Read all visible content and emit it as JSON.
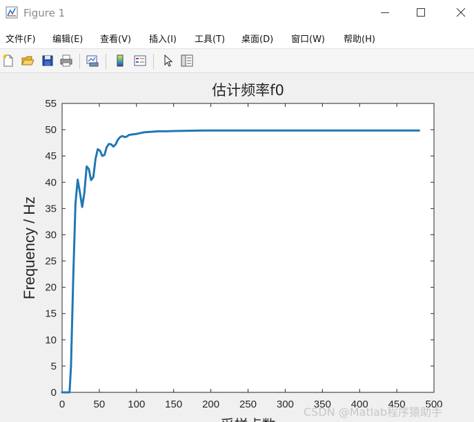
{
  "window": {
    "title": "Figure 1",
    "controls": [
      "minimize",
      "maximize",
      "close"
    ]
  },
  "menu": {
    "items": [
      "文件(F)",
      "编辑(E)",
      "查看(V)",
      "插入(I)",
      "工具(T)",
      "桌面(D)",
      "窗口(W)",
      "帮助(H)"
    ]
  },
  "toolbar": {
    "icons": [
      "new-figure-icon",
      "open-file-icon",
      "save-icon",
      "print-icon",
      "link-plot-icon",
      "colorbar-icon",
      "legend-icon",
      "pointer-icon",
      "property-inspector-icon"
    ]
  },
  "colors": {
    "line": "#1f77b4",
    "axes_bg": "#ffffff",
    "figure_bg": "#f0f0f0"
  },
  "watermark": "CSDN @Matlab程序猿助手",
  "chart_data": {
    "type": "line",
    "title": "估计频率f0",
    "xlabel": "采样点数",
    "ylabel": "Frequency / Hz",
    "xlim": [
      0,
      500
    ],
    "ylim": [
      0,
      55
    ],
    "xticks": [
      0,
      50,
      100,
      150,
      200,
      250,
      300,
      350,
      400,
      450,
      500
    ],
    "yticks": [
      0,
      5,
      10,
      15,
      20,
      25,
      30,
      35,
      40,
      45,
      50,
      55
    ],
    "grid": false,
    "series": [
      {
        "x": [
          0,
          10,
          12,
          15,
          18,
          21,
          24,
          27,
          30,
          33,
          36,
          39,
          42,
          45,
          48,
          51,
          54,
          57,
          60,
          63,
          66,
          69,
          72,
          75,
          78,
          81,
          84,
          87,
          90,
          95,
          100,
          110,
          120,
          130,
          140,
          150,
          170,
          190,
          210,
          250,
          300,
          350,
          400,
          450,
          480
        ],
        "y": [
          0,
          0,
          5,
          22,
          36,
          40.5,
          38,
          35.3,
          38,
          43,
          42.5,
          40.4,
          41,
          44.5,
          46.3,
          46,
          45,
          45.2,
          46.7,
          47.3,
          47.2,
          46.8,
          47.2,
          48.1,
          48.6,
          48.8,
          48.6,
          48.7,
          49,
          49.1,
          49.2,
          49.5,
          49.6,
          49.7,
          49.7,
          49.75,
          49.8,
          49.85,
          49.85,
          49.85,
          49.85,
          49.85,
          49.85,
          49.85,
          49.85
        ]
      }
    ]
  }
}
